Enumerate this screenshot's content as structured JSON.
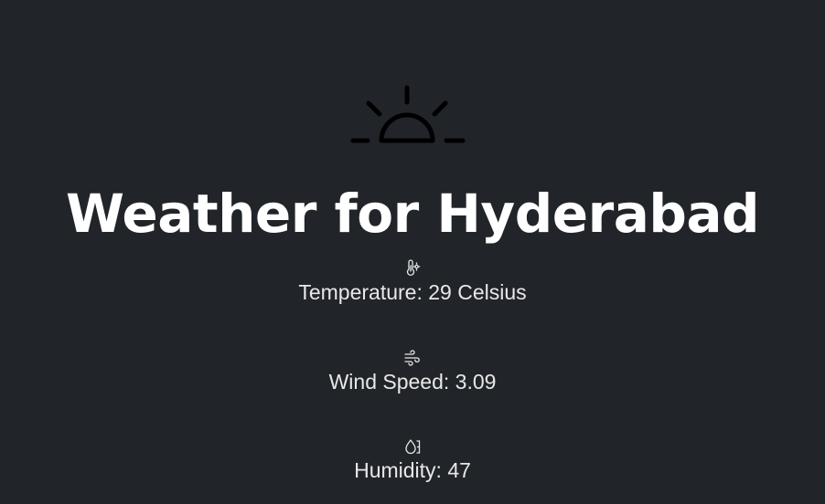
{
  "header": {
    "icon": "sunrise-icon",
    "title": "Weather for Hyderabad"
  },
  "stats": [
    {
      "icon": "thermometer-sun-icon",
      "label": "Temperature: 29 Celsius"
    },
    {
      "icon": "wind-icon",
      "label": "Wind Speed: 3.09"
    },
    {
      "icon": "humidity-icon",
      "label": "Humidity: 47"
    }
  ],
  "colors": {
    "background": "#212429",
    "title": "#ffffff",
    "text": "#e8e8e8",
    "hero_icon": "#000000"
  }
}
